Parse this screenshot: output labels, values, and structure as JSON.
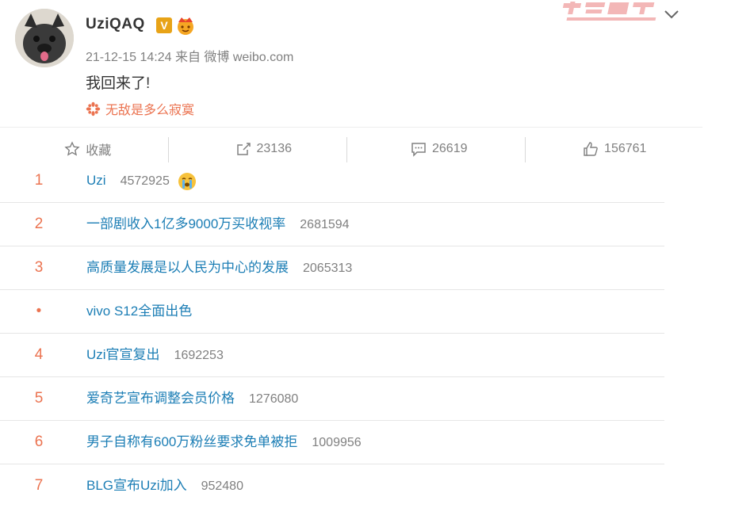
{
  "post": {
    "username": "UziQAQ",
    "badge_v": "V",
    "timestamp": "21-12-15 14:24",
    "source": "来自 微博 weibo.com",
    "content": "我回来了!",
    "topic": "无敌是多么寂寞"
  },
  "actions": {
    "favorite": "收藏",
    "repost": "23136",
    "comment": "26619",
    "like": "156761"
  },
  "hot_list": [
    {
      "rank": "1",
      "title": "Uzi",
      "count": "4572925",
      "emoji": "crying-face"
    },
    {
      "rank": "2",
      "title": "一部剧收入1亿多9000万买收视率",
      "count": "2681594"
    },
    {
      "rank": "3",
      "title": "高质量发展是以人民为中心的发展",
      "count": "2065313"
    },
    {
      "rank": "•",
      "title": "vivo S12全面出色",
      "count": ""
    },
    {
      "rank": "4",
      "title": "Uzi官宣复出",
      "count": "1692253"
    },
    {
      "rank": "5",
      "title": "爱奇艺宣布调整会员价格",
      "count": "1276080"
    },
    {
      "rank": "6",
      "title": "男子自称有600万粉丝要求免单被拒",
      "count": "1009956"
    },
    {
      "rank": "7",
      "title": "BLG宣布Uzi加入",
      "count": "952480"
    }
  ],
  "colors": {
    "link": "#1c7eb5",
    "rank": "#eb7350",
    "muted": "#808080"
  }
}
